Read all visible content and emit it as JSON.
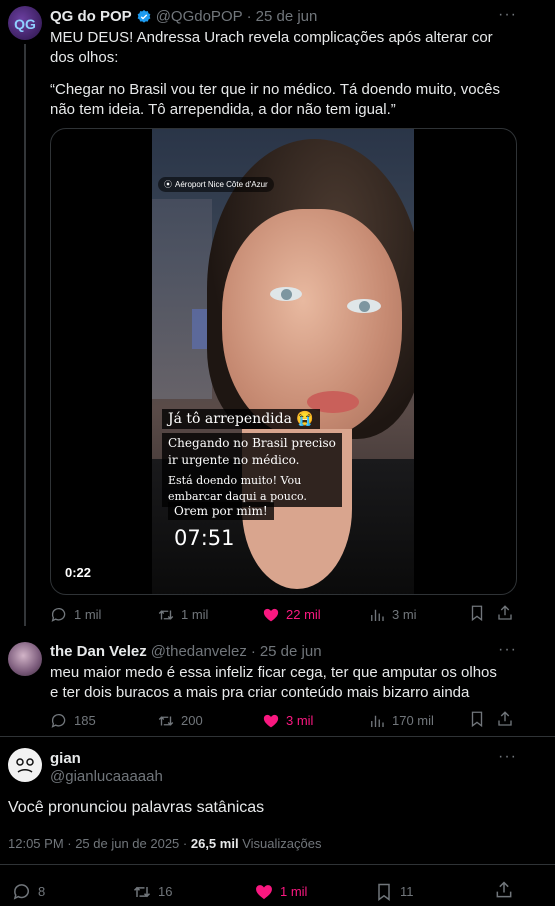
{
  "colors": {
    "bg": "#000000",
    "text": "#e7e9ea",
    "muted": "#71767b",
    "like": "#f91880",
    "verified": "#1d9bf0",
    "border": "#2f3336"
  },
  "tweet1": {
    "name": "QG do POP",
    "handle": "@QGdoPOP",
    "date": "25 de jun",
    "text1": "MEU DEUS! Andressa Urach revela complicações após alterar cor dos olhos:",
    "text2": "“Chegar no Brasil vou ter que ir no médico. Tá doendo muito, vocês não tem ideia. Tô arrependida, a dor não tem igual.”",
    "video": {
      "location": "Aéroport Nice Côte d'Azur",
      "caption1": "Já tô arrependida 😭",
      "caption2": "Chegando no Brasil preciso ir urgente no médico.",
      "caption3": "Está doendo muito! Vou embarcar daqui a pouco.",
      "caption4": "Orem por mim!",
      "clock": "07:51",
      "duration": "0:22"
    },
    "stats": {
      "replies": "1 mil",
      "retweets": "1 mil",
      "likes": "22 mil",
      "views": "3 mi"
    }
  },
  "tweet2": {
    "name": "the Dan Velez",
    "handle": "@thedanvelez",
    "date": "25 de jun",
    "text": "meu maior medo é essa infeliz ficar cega, ter que amputar os olhos e ter dois buracos a mais pra criar conteúdo mais bizarro ainda",
    "stats": {
      "replies": "185",
      "retweets": "200",
      "likes": "3 mil",
      "views": "170 mil"
    }
  },
  "main": {
    "name": "gian",
    "handle": "@gianlucaaaaah",
    "text": "Você pronunciou palavras satânicas",
    "meta": {
      "time": "12:05 PM · 25 de jun de 2025 · ",
      "views_count": "26,5 mil",
      "views_label": "Visualizações"
    },
    "stats": {
      "replies": "8",
      "retweets": "16",
      "likes": "1 mil",
      "bookmarks": "11"
    }
  }
}
